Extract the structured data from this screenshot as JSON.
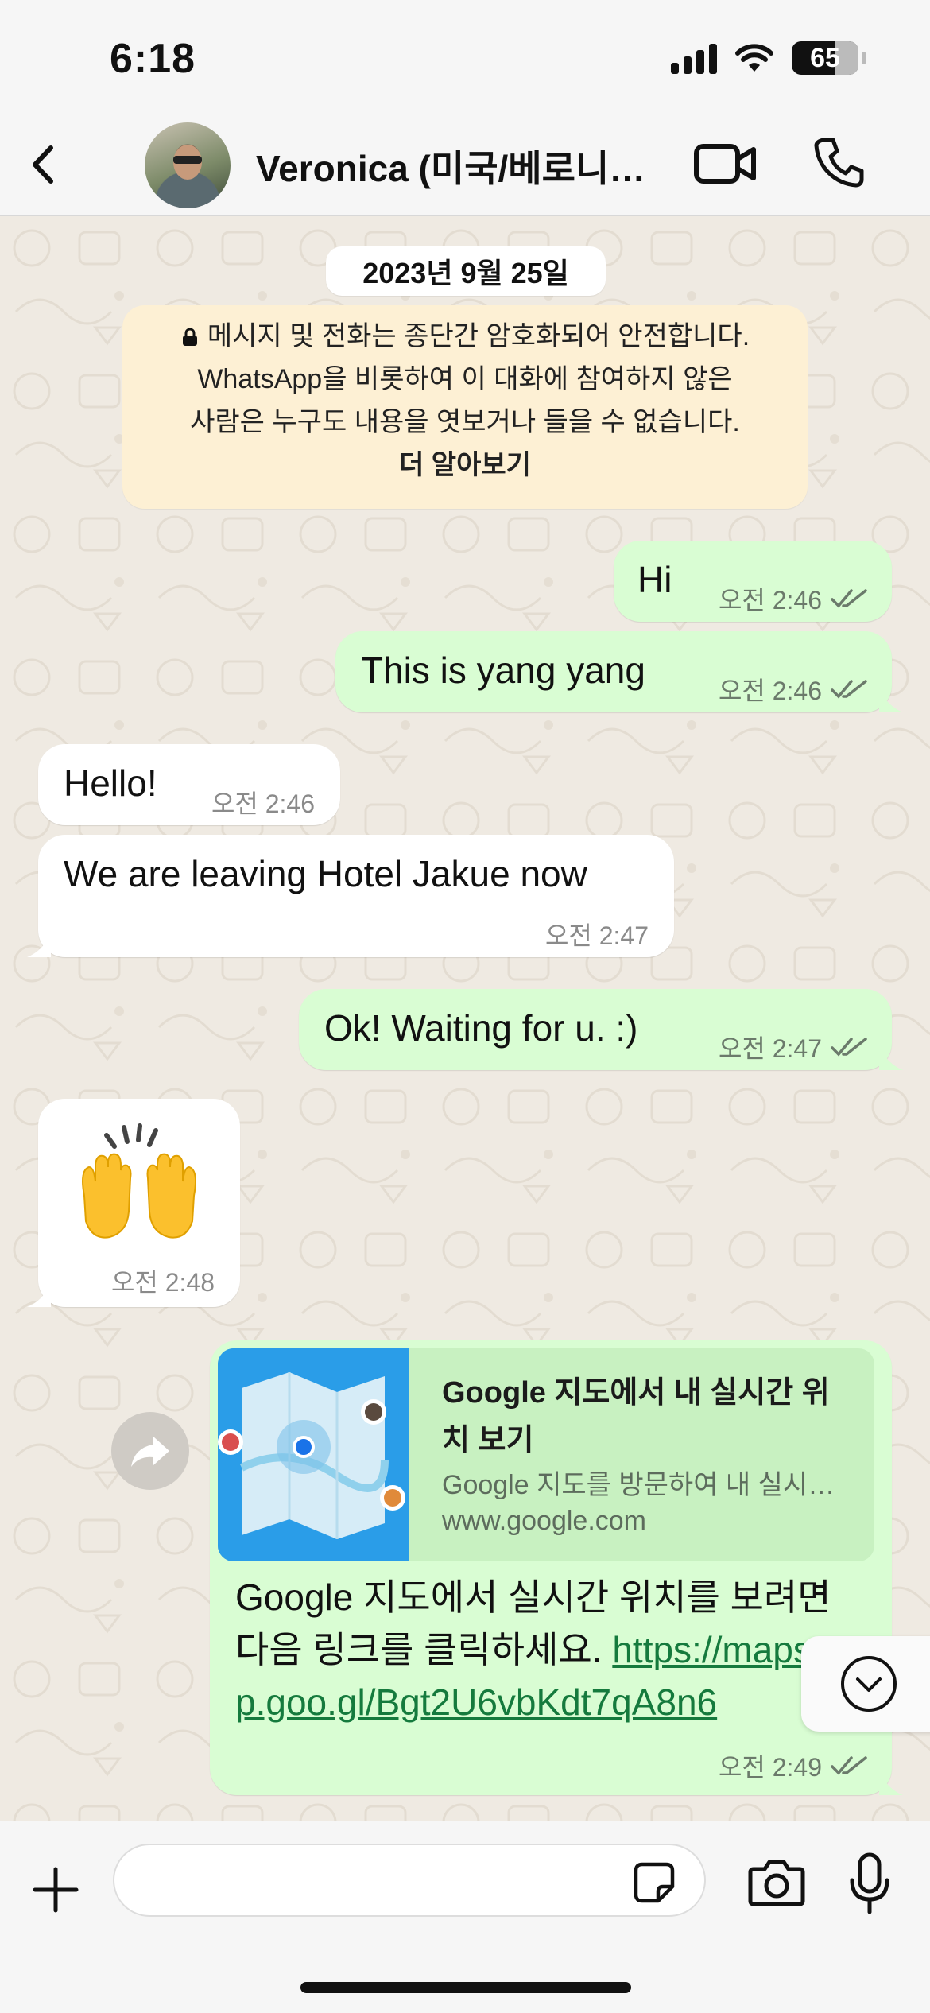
{
  "status_bar": {
    "time": "6:18",
    "battery": "65"
  },
  "header": {
    "contact_name": "Veronica (미국/베로니…",
    "back_icon": "chevron-left-icon",
    "video_icon": "video-camera-icon",
    "phone_icon": "phone-icon"
  },
  "chat": {
    "date": "2023년 9월 25일",
    "encryption_notice": {
      "line1": "메시지 및 전화는 종단간 암호화되어 안전합니다.",
      "line2": "WhatsApp을 비롯하여 이 대화에 참여하지 않은",
      "line3": "사람은 누구도 내용을 엿보거나 들을 수 없습니다.",
      "learn_more": "더 알아보기"
    },
    "messages": [
      {
        "direction": "out",
        "text": "Hi",
        "time": "오전 2:46",
        "read": true
      },
      {
        "direction": "out",
        "text": "This is yang yang",
        "time": "오전 2:46",
        "read": true
      },
      {
        "direction": "in",
        "text": "Hello!",
        "time": "오전 2:46"
      },
      {
        "direction": "in",
        "text": "We are leaving Hotel Jakue now",
        "time": "오전 2:47"
      },
      {
        "direction": "out",
        "text": "Ok! Waiting for u. :)",
        "time": "오전 2:47",
        "read": true
      },
      {
        "direction": "in",
        "text": "🙌",
        "time": "오전 2:48"
      },
      {
        "direction": "out",
        "time": "오전 2:49",
        "read": true,
        "link_preview": {
          "title": "Google 지도에서 내 실시간 위치 보기",
          "description": "Google 지도를 방문하여 내 실시…",
          "domain": "www.google.com"
        },
        "text": "Google 지도에서 실시간 위치를 보려면 다음 링크를 클릭하세요.",
        "link": "https://maps.app.goo.gl/Bgt2U6vbKdt7qA8n6"
      }
    ]
  },
  "input_bar": {
    "placeholder": "",
    "icons": [
      "plus-icon",
      "sticker-icon",
      "camera-icon",
      "microphone-icon"
    ]
  },
  "colors": {
    "outgoing_bubble": "#d9fdd3",
    "incoming_bubble": "#ffffff",
    "chat_background": "#efeae2",
    "encryption_box": "#fdf0d4",
    "link_color": "#157a3d"
  }
}
